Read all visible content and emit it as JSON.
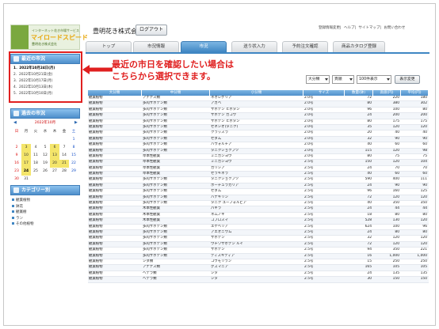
{
  "header": {
    "logo_line1": "インターネット花き市場サービス",
    "logo_line2": "マイロードスピード",
    "logo_line3": "豊明花き株式会社",
    "company": "豊明花き株式会社様",
    "logout_label": "ログアウト",
    "links": [
      "登録情報変更",
      "ヘルプ",
      "サイトマップ",
      "お問い合わせ"
    ]
  },
  "tabs": [
    {
      "label": "トップ",
      "active": false
    },
    {
      "label": "市況情報",
      "active": false
    },
    {
      "label": "市況",
      "active": true
    },
    {
      "label": "送り状入力",
      "active": false
    },
    {
      "label": "予約注文確認",
      "active": false
    },
    {
      "label": "商品カタログ登録",
      "active": false
    }
  ],
  "sidebar": {
    "recent_title": "最近の市況",
    "recent_items": [
      "1．2022年10月24日(月)",
      "2．2022年10月21日(金)",
      "3．2022年10月17日(月)",
      "4．2022年10月13日(木)",
      "5．2022年10月10日(月)"
    ],
    "past_title": "過去の市況",
    "calendar": {
      "month": "2022年10月",
      "prev": "◀",
      "next": "▶",
      "weekdays": [
        "日",
        "月",
        "火",
        "水",
        "木",
        "金",
        "土"
      ],
      "weeks": [
        [
          "",
          "",
          "",
          "",
          "",
          "",
          "1"
        ],
        [
          "2",
          "3",
          "4",
          "5",
          "6",
          "7",
          "8"
        ],
        [
          "9",
          "10",
          "11",
          "12",
          "13",
          "14",
          "15"
        ],
        [
          "16",
          "17",
          "18",
          "19",
          "20",
          "21",
          "22"
        ],
        [
          "23",
          "24",
          "25",
          "26",
          "27",
          "28",
          "29"
        ],
        [
          "30",
          "31",
          "",
          "",
          "",
          "",
          ""
        ]
      ],
      "marked": [
        "3",
        "6",
        "10",
        "13",
        "17",
        "20",
        "21",
        "24"
      ],
      "today": "24"
    },
    "category_title": "カテゴリー別",
    "categories": [
      "観葉植物",
      "鉢花",
      "観賞樹",
      "ラン",
      "その他植物"
    ]
  },
  "annotation": {
    "line1": "最近の市日を確認したい場合は",
    "line2": "こちらから選択できます。"
  },
  "filters": {
    "category": "大分類",
    "grade": "頁順",
    "per_page": "100件表示",
    "change_label": "表示変更"
  },
  "table": {
    "headers": [
      "大分類",
      "中分類",
      "小分類",
      "サイズ",
      "数量(鉢)",
      "高値(円)",
      "平均(円)"
    ],
    "rows": [
      [
        "観葉植物",
        "アナナス類",
        "ネオレゲリア",
        "2.0号",
        "72",
        "220",
        "180"
      ],
      [
        "観葉植物",
        "多肉サボテン類",
        "アガベ",
        "2.0号",
        "80",
        "380",
        "302"
      ],
      [
        "観葉植物",
        "多肉サボテン類",
        "サボテン ヒボタン",
        "2.0号",
        "96",
        "100",
        "80"
      ],
      [
        "観葉植物",
        "多肉サボテン類",
        "サボテン カコウ",
        "2.0号",
        "24",
        "200",
        "200"
      ],
      [
        "観葉植物",
        "多肉サボテン類",
        "サボテン ヒボタン",
        "2.0号",
        "80",
        "175",
        "175"
      ],
      [
        "観葉植物",
        "多肉サボテン類",
        "セネシオ(タニク)",
        "2.0号",
        "35",
        "120",
        "120"
      ],
      [
        "観葉植物",
        "多肉サボテン類",
        "クラッスラ",
        "2.0号",
        "20",
        "40",
        "40"
      ],
      [
        "観葉植物",
        "多肉サボテン類",
        "セダム",
        "2.0号",
        "32",
        "90",
        "90"
      ],
      [
        "観葉植物",
        "多肉サボテン類",
        "ハウォルチア",
        "2.0号",
        "40",
        "60",
        "60"
      ],
      [
        "観葉植物",
        "多肉サボテン類",
        "タニクショクブツ",
        "2.0号",
        "115",
        "120",
        "98"
      ],
      [
        "観葉植物",
        "草本性観葉",
        "ミニカンヨウ",
        "2.0号",
        "80",
        "75",
        "75"
      ],
      [
        "観葉植物",
        "草本性観葉",
        "ミニカンヨウ",
        "2.5号",
        "150",
        "120",
        "104"
      ],
      [
        "観葉植物",
        "草本性観葉",
        "カリシア",
        "2.5号",
        "24",
        "70",
        "70"
      ],
      [
        "観葉植物",
        "草本性観葉",
        "セラギネラ",
        "2.5号",
        "40",
        "60",
        "60"
      ],
      [
        "観葉植物",
        "多肉サボテン類",
        "タニクショクブツ",
        "2.5号",
        "590",
        "400",
        "111"
      ],
      [
        "観葉植物",
        "多肉サボテン類",
        "ポーチュラカリア",
        "2.5号",
        "24",
        "90",
        "90"
      ],
      [
        "観葉植物",
        "多肉サボテン類",
        "セダム",
        "2.5号",
        "96",
        "160",
        "125"
      ],
      [
        "観葉植物",
        "多肉サボテン類",
        "ハナキリン",
        "2.5号",
        "72",
        "120",
        "120"
      ],
      [
        "観葉植物",
        "多肉サボテン類",
        "タニク ユーフォルビア",
        "2.5号",
        "40",
        "350",
        "350"
      ],
      [
        "観葉植物",
        "木本性観葉",
        "パキラ",
        "2.5号",
        "24",
        "44",
        "44"
      ],
      [
        "観葉植物",
        "木本性観葉",
        "ネムノキ",
        "2.5号",
        "18",
        "80",
        "80"
      ],
      [
        "観葉植物",
        "木本性観葉",
        "コプロスマ",
        "2.5号",
        "528",
        "130",
        "120"
      ],
      [
        "観葉植物",
        "多肉サボテン類",
        "エケベリア",
        "2.5号",
        "624",
        "100",
        "96"
      ],
      [
        "観葉植物",
        "多肉サボテン類",
        "アエオニウム",
        "2.5号",
        "24",
        "80",
        "80"
      ],
      [
        "観葉植物",
        "多肉サボテン類",
        "サボテン",
        "2.5号",
        "32",
        "120",
        "120"
      ],
      [
        "観葉植物",
        "多肉サボテン類",
        "ウチワサボテン ルイ",
        "2.5号",
        "72",
        "120",
        "120"
      ],
      [
        "観葉植物",
        "多肉サボテン類",
        "サボテン",
        "2.5号",
        "94",
        "350",
        "221"
      ],
      [
        "観葉植物",
        "多肉サボテン類",
        "ディスキディア",
        "2.5号",
        "16",
        "1,000",
        "1,000"
      ],
      [
        "観葉植物",
        "シダ類",
        "コウモリラン",
        "2.5号",
        "15",
        "250",
        "250"
      ],
      [
        "観葉植物",
        "アナナス類",
        "グズマニア",
        "2.5号",
        "165",
        "105",
        "105"
      ],
      [
        "観葉植物",
        "ヘデラ類",
        "シタ",
        "2.5号",
        "24",
        "135",
        "135"
      ],
      [
        "観葉植物",
        "ヘデラ類",
        "シタ",
        "2.5号",
        "30",
        "150",
        "150"
      ]
    ]
  }
}
